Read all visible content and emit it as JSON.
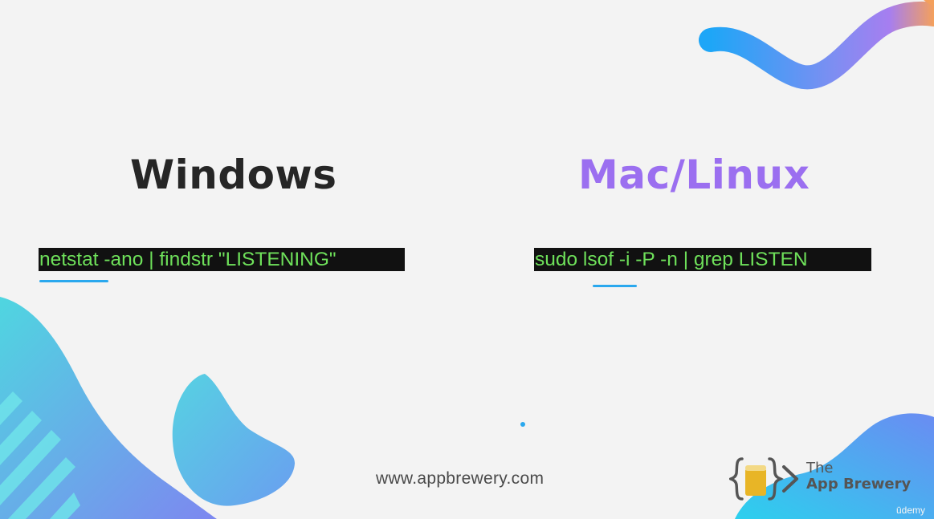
{
  "slide": {
    "windows_heading": "Windows",
    "mac_heading": "Mac/Linux",
    "windows_command": "netstat -ano | findstr \"LISTENING\"",
    "mac_command": "sudo lsof -i -P -n | grep LISTEN",
    "website": "www.appbrewery.com"
  },
  "logo": {
    "line1": "The",
    "line2": "App Brewery"
  },
  "watermark": "ūdemy",
  "colors": {
    "background": "#f3f3f3",
    "windows_heading": "#262626",
    "mac_heading": "#9b6ff0",
    "command_text": "#6ee05a",
    "command_highlight": "#111111",
    "underline": "#2aa8ee",
    "wave_start": "#1ea6f7",
    "wave_mid": "#a67ef0",
    "wave_end": "#f4a05c",
    "blob_cyan": "#4dd6e2",
    "blob_blue": "#6f8ff0",
    "logo_glass": "#e8b526"
  },
  "icons": {
    "logo": "app-brewery-logo-icon"
  }
}
